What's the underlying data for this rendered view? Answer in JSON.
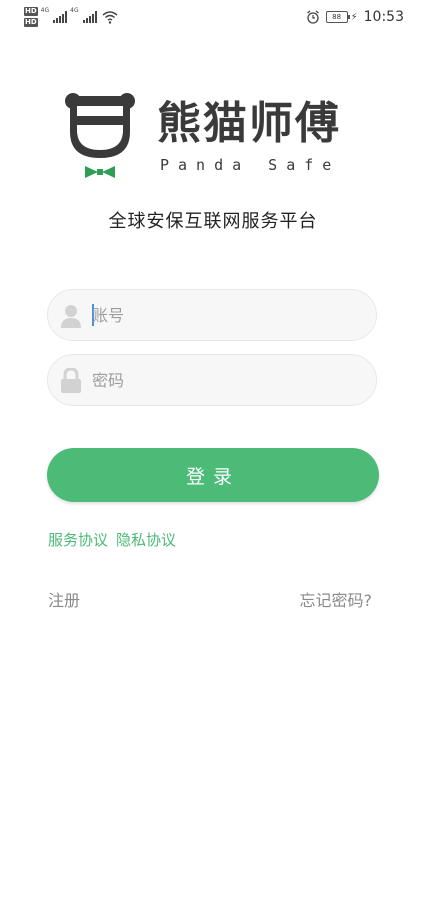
{
  "status_bar": {
    "hd1": "HD",
    "hd2": "HD",
    "net1": "4G",
    "net2": "4G",
    "battery": "88",
    "time": "10:53",
    "icons": [
      "signal-icon",
      "wifi-icon",
      "alarm-icon",
      "battery-icon",
      "charging-icon"
    ]
  },
  "brand": {
    "name": "熊猫师傅",
    "sub": "Panda Safe",
    "tagline": "全球安保互联网服务平台",
    "colors": {
      "primary": "#4cbb78",
      "dark": "#3a3a3a"
    }
  },
  "form": {
    "account_placeholder": "账号",
    "password_placeholder": "密码",
    "login_label": "登录"
  },
  "links": {
    "service_agreement": "服务协议",
    "privacy_agreement": "隐私协议",
    "register": "注册",
    "forgot_password": "忘记密码?"
  }
}
